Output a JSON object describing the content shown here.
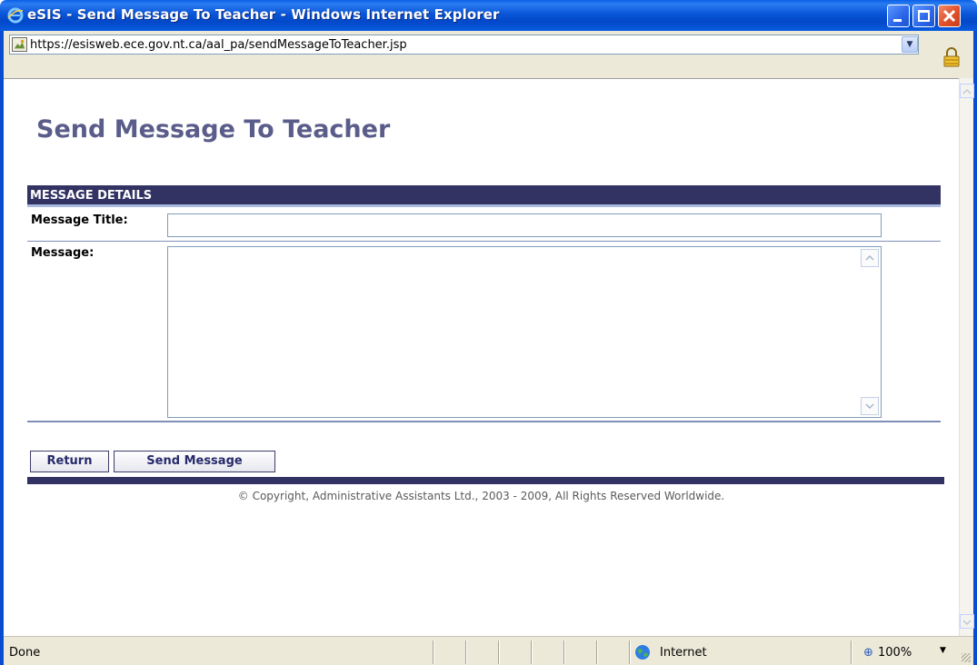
{
  "window": {
    "title": "eSIS - Send Message To Teacher - Windows Internet Explorer",
    "url": "https://esisweb.ece.gov.nt.ca/aal_pa/sendMessageToTeacher.jsp"
  },
  "page": {
    "title": "Send Message To Teacher",
    "section_header": "MESSAGE DETAILS",
    "fields": {
      "title_label": "Message Title:",
      "title_value": "",
      "message_label": "Message:",
      "message_value": ""
    },
    "buttons": {
      "return_label": "Return",
      "send_label": "Send Message"
    },
    "copyright": "© Copyright, Administrative Assistants Ltd., 2003 - 2009, All Rights Reserved Worldwide."
  },
  "statusbar": {
    "status": "Done",
    "zone": "Internet",
    "zoom": "100%"
  },
  "colors": {
    "header_bg": "#323263",
    "title_color": "#5a5c8a",
    "titlebar_blue": "#0a55d8"
  }
}
